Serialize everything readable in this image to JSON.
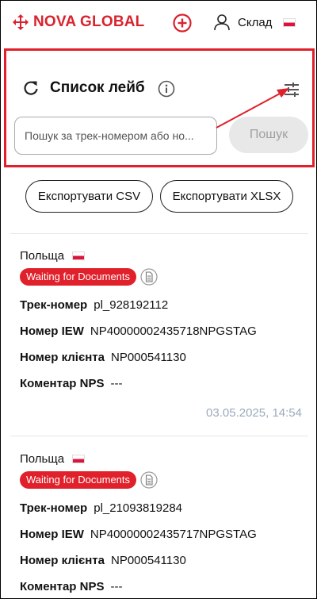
{
  "header": {
    "logo_text": "NOVA GLOBAL",
    "user_label": "Склад",
    "brand_color": "#d9232e"
  },
  "panel": {
    "title": "Список лейб",
    "search_placeholder": "Пошук за трек-номером або но...",
    "search_button": "Пошук"
  },
  "export": {
    "csv_label": "Експортувати CSV",
    "xlsx_label": "Експортувати XLSX"
  },
  "labels": {
    "track": "Трек-номер",
    "iew": "Номер IEW",
    "client": "Номер клієнта",
    "comment": "Коментар NPS"
  },
  "items": [
    {
      "country": "Польща",
      "status": "Waiting for Documents",
      "track": "pl_928192112",
      "iew": "NP40000002435718NPGSTAG",
      "client": "NP000541130",
      "comment": "---",
      "timestamp": "03.05.2025, 14:54"
    },
    {
      "country": "Польща",
      "status": "Waiting for Documents",
      "track": "pl_21093819284",
      "iew": "NP40000002435717NPGSTAG",
      "client": "NP000541130",
      "comment": "---"
    }
  ]
}
